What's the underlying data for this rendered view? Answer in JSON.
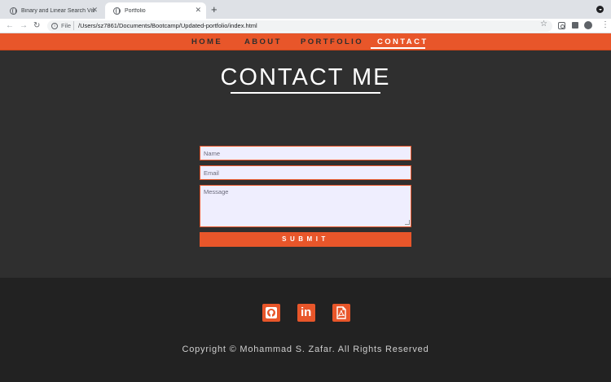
{
  "browser": {
    "tabs": [
      {
        "label": "Binary and Linear Search Visu",
        "active": false
      },
      {
        "label": "Portfolio",
        "active": true
      }
    ],
    "new_tab": "+",
    "close_glyph": "✕",
    "url_scheme": "File",
    "url": "/Users/sz7861/Documents/Bootcamp/Updated-portfolio/index.html"
  },
  "site_nav": {
    "items": [
      "HOME",
      "ABOUT",
      "PORTFOLIO",
      "CONTACT"
    ],
    "active": "CONTACT"
  },
  "contact": {
    "title": "CONTACT ME",
    "name_placeholder": "Name",
    "email_placeholder": "Email",
    "message_placeholder": "Message",
    "submit_label": "SUBMIT"
  },
  "footer": {
    "social_icons": [
      "github-icon",
      "linkedin-icon",
      "pdf-resume-icon"
    ],
    "linkedin_glyph": "in",
    "copyright": "Copyright © Mohammad S. Zafar. All Rights Reserved"
  },
  "colors": {
    "accent": "#e8562a",
    "section_bg": "#2f2f2f",
    "footer_bg": "#222222",
    "input_bg": "#efeefe"
  }
}
